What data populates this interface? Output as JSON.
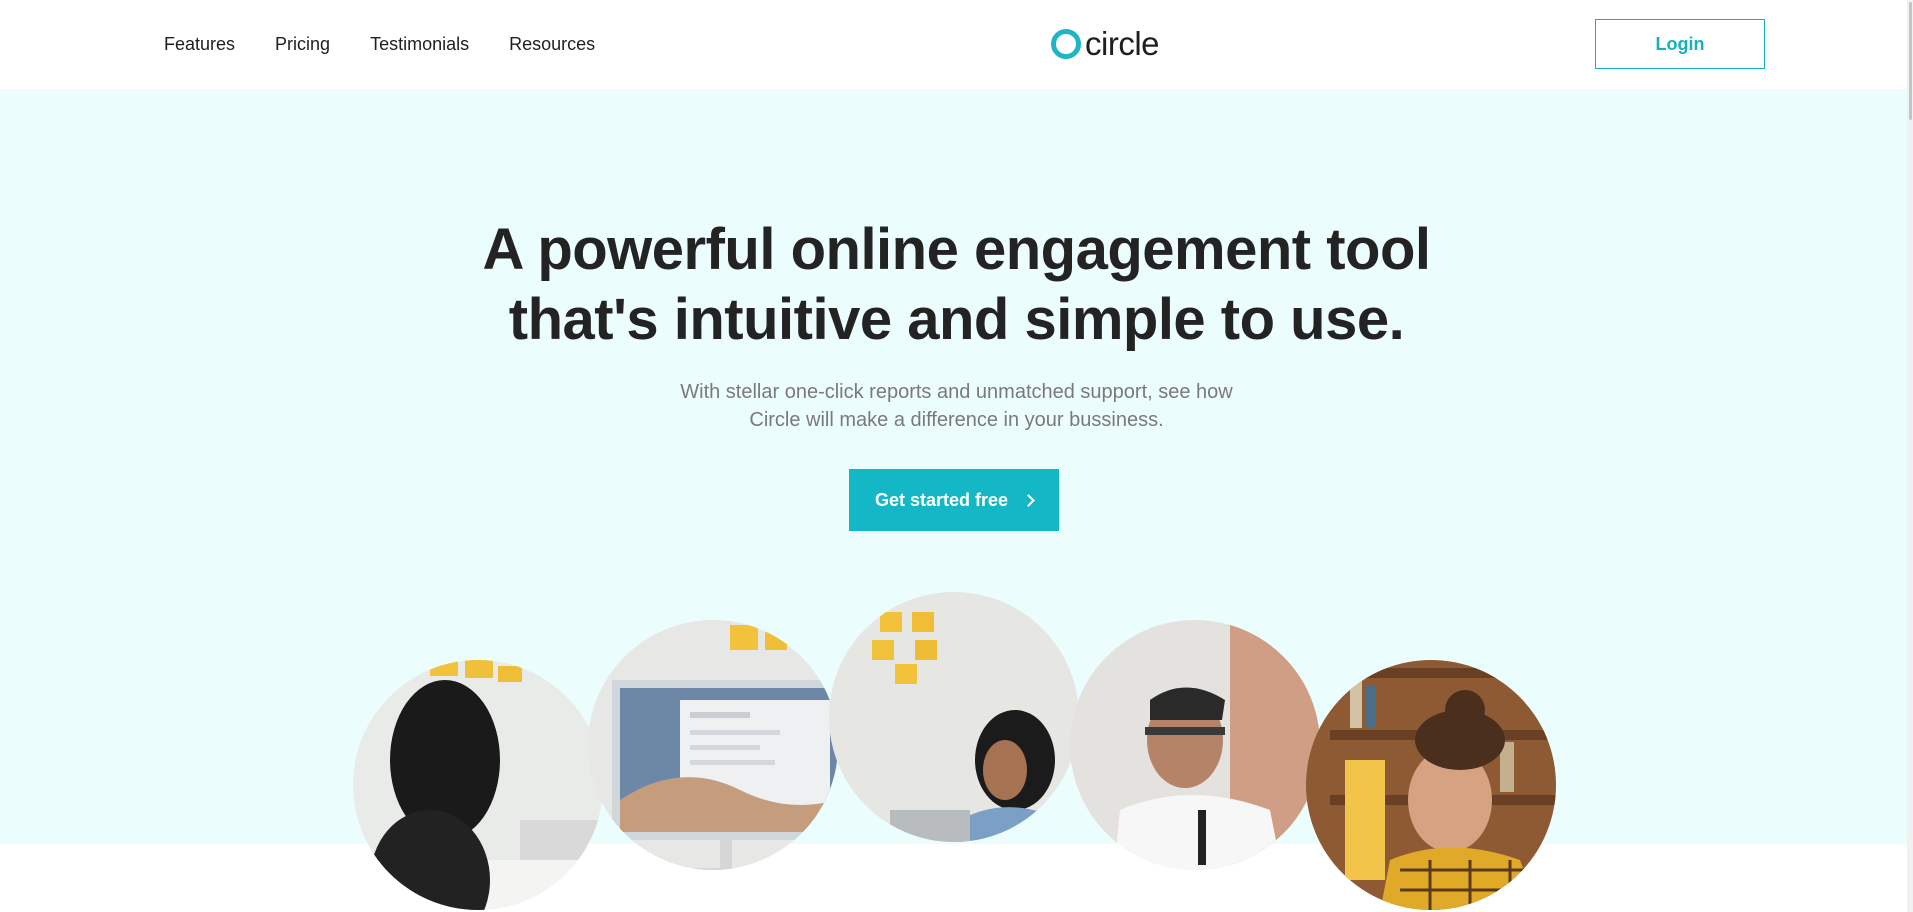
{
  "header": {
    "nav": [
      "Features",
      "Pricing",
      "Testimonials",
      "Resources"
    ],
    "logo_text": "circle",
    "login_label": "Login"
  },
  "hero": {
    "headline_line1": "A powerful online engagement tool",
    "headline_line2": "that's intuitive and simple to use.",
    "sub_line1": "With stellar one-click reports and unmatched support, see how",
    "sub_line2": "Circle will make a difference in your bussiness.",
    "cta_label": "Get started free"
  },
  "colors": {
    "accent": "#14b7c5",
    "hero_bg": "#ecfdfd",
    "heading": "#232323",
    "muted": "#7a7a7a"
  },
  "icons": {
    "logo": "ring-icon",
    "cta": "chevron-right-icon"
  }
}
